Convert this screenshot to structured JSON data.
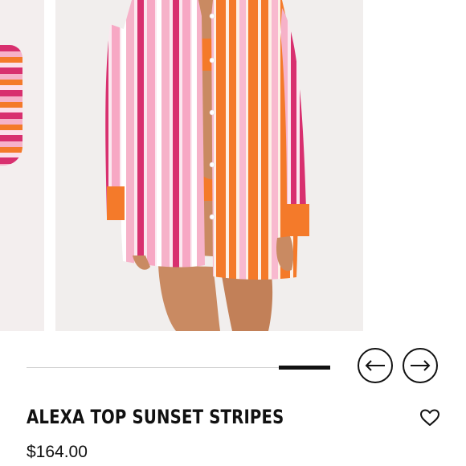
{
  "product": {
    "title": "ALEXA TOP SUNSET STRIPES",
    "price": "$164.00",
    "image_alt": "Model wearing oversized pink, magenta, orange and white striped button-down shirt over orange bikini"
  },
  "gallery": {
    "progress": 0.17,
    "prev_icon": "arrow-left-icon",
    "next_icon": "arrow-right-icon"
  },
  "actions": {
    "wishlist_icon": "heart-outline-icon"
  },
  "colors": {
    "magenta": "#d8306f",
    "pink": "#f6b2c9",
    "orange": "#f47a2a",
    "white_stripe": "#fbe8ef",
    "text": "#111111"
  }
}
